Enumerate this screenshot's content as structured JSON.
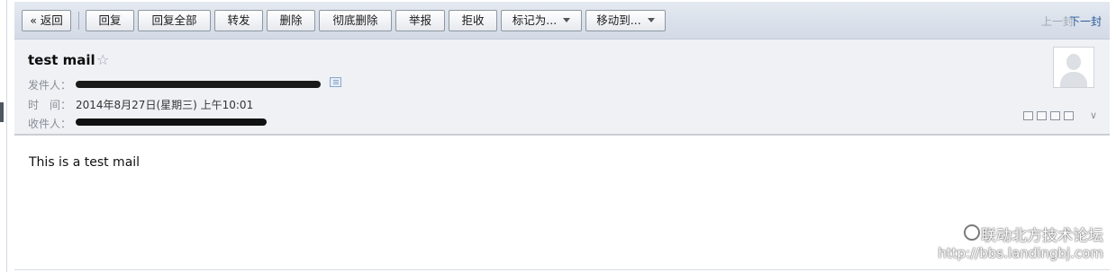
{
  "toolbar": {
    "back_label": "« 返回",
    "buttons": [
      "回复",
      "回复全部",
      "转发",
      "删除",
      "彻底删除",
      "举报",
      "拒收"
    ],
    "mark_as_label": "标记为...",
    "move_to_label": "移动到...",
    "prev_label": "上一封",
    "next_label": "下一封"
  },
  "message": {
    "subject": "test mail",
    "from_label": "发件人：",
    "date_label": "时　间：",
    "date_value": "2014年8月27日(星期三) 上午10:01",
    "to_label": "收件人：",
    "body": "This is a test mail"
  },
  "watermark": {
    "line1": "联动北方技术论坛",
    "line2": "http://bbs.landingbj.com"
  },
  "colors": {
    "toolbar_bg": "#d3dae6",
    "header_bg": "#eff1f5",
    "link_blue": "#2a5c99"
  }
}
